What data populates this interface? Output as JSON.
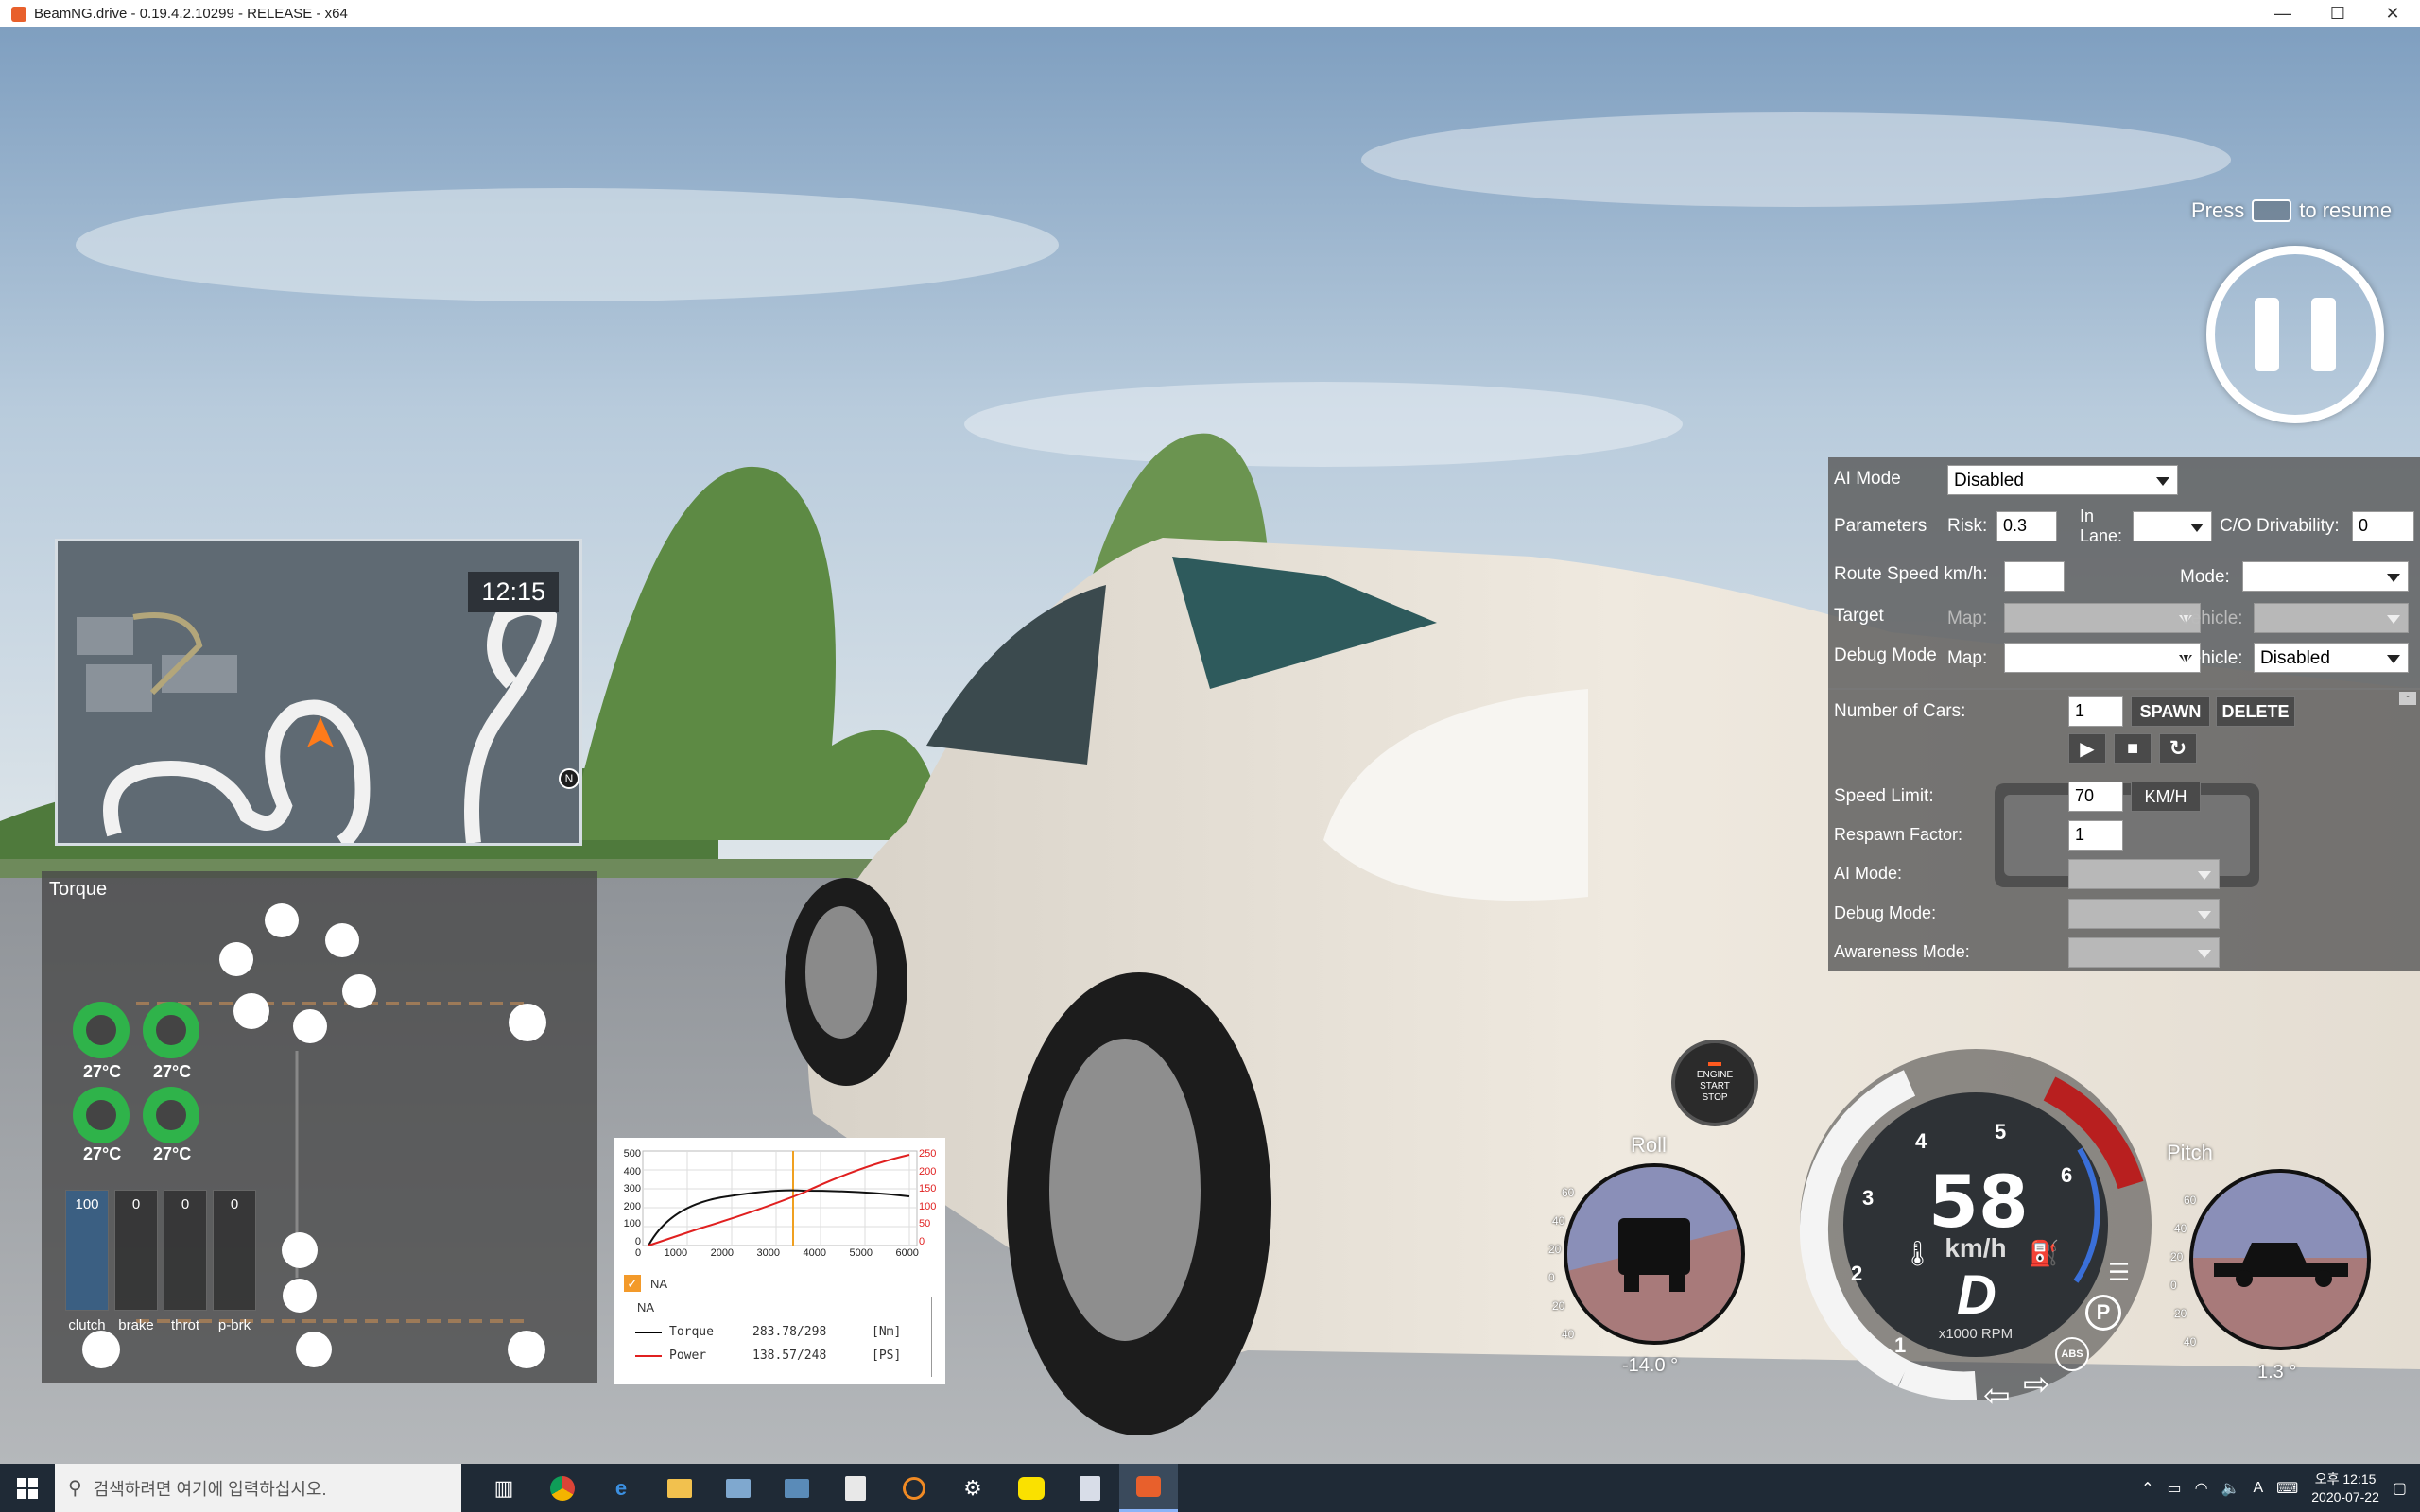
{
  "window": {
    "title": "BeamNG.drive - 0.19.4.2.10299 - RELEASE - x64"
  },
  "pause": {
    "press_label": "Press",
    "resume_label": "to resume"
  },
  "minimap": {
    "time": "12:15",
    "north": "N"
  },
  "torque_panel": {
    "title": "Torque",
    "wheel_temps": [
      "27°C",
      "27°C",
      "27°C",
      "27°C"
    ],
    "pedals": [
      {
        "label": "clutch",
        "value": "100",
        "fill": 1.0
      },
      {
        "label": "brake",
        "value": "0",
        "fill": 0
      },
      {
        "label": "throt",
        "value": "0",
        "fill": 0
      },
      {
        "label": "p-brk",
        "value": "0",
        "fill": 0
      }
    ]
  },
  "torque_graph": {
    "left_ticks": [
      "500",
      "400",
      "300",
      "200",
      "100",
      "0"
    ],
    "right_ticks": [
      "250",
      "200",
      "150",
      "100",
      "50",
      "0"
    ],
    "x_ticks": [
      "0",
      "1000",
      "2000",
      "3000",
      "4000",
      "5000",
      "6000"
    ],
    "checkbox_label": "NA",
    "header": "NA",
    "rows": [
      {
        "name": "Torque",
        "value": "283.78/298",
        "unit": "[Nm]",
        "color": "#000000"
      },
      {
        "name": "Power",
        "value": "138.57/248",
        "unit": "[PS]",
        "color": "#e02020"
      }
    ]
  },
  "ai_panel": {
    "ai_mode_label": "AI Mode",
    "ai_mode_value": "Disabled",
    "parameters_label": "Parameters",
    "risk_label": "Risk:",
    "risk_value": "0.3",
    "in_lane_label": "In Lane:",
    "co_drivability_label": "C/O Drivability:",
    "co_drivability_value": "0",
    "route_speed_label": "Route Speed km/h:",
    "route_speed_value": "",
    "mode_label": "Mode:",
    "target_label": "Target",
    "map_label": "Map:",
    "vehicle_label": "Vehicle:",
    "debug_mode_label": "Debug Mode",
    "debug_vehicle_value": "Disabled",
    "number_of_cars_label": "Number of Cars:",
    "number_of_cars_value": "1",
    "spawn_label": "SPAWN",
    "delete_label": "DELETE",
    "speed_limit_label": "Speed Limit:",
    "speed_limit_value": "70",
    "speed_unit_label": "KM/H",
    "respawn_factor_label": "Respawn Factor:",
    "respawn_factor_value": "1",
    "ai_mode2_label": "AI Mode:",
    "debug_mode2_label": "Debug Mode:",
    "awareness_mode_label": "Awareness Mode:"
  },
  "engine_button": {
    "line1": "ENGINE",
    "line2": "START",
    "line3": "STOP"
  },
  "roll_gauge": {
    "title": "Roll",
    "value": "-14.0 °",
    "ticks": [
      "60",
      "40",
      "20",
      "0",
      "20",
      "40"
    ]
  },
  "pitch_gauge": {
    "title": "Pitch",
    "value": "1.3 °",
    "ticks": [
      "60",
      "40",
      "20",
      "0",
      "20",
      "40"
    ]
  },
  "speedometer": {
    "speed": "58",
    "unit": "km/h",
    "gear": "D",
    "rpm_label": "x1000 RPM",
    "rpm_ticks": [
      "1",
      "2",
      "3",
      "4",
      "5",
      "6"
    ],
    "abs_label": "ABS",
    "park_label": "P"
  },
  "taskbar": {
    "search_placeholder": "검색하려면 여기에 입력하십시오.",
    "clock_period_time": "오후 12:15",
    "clock_date": "2020-07-22",
    "ime_label": "A"
  },
  "colors": {
    "accent_green": "#2fb34a",
    "brake_red": "#cc1f1f",
    "speed_blue": "#3a6fd8"
  }
}
